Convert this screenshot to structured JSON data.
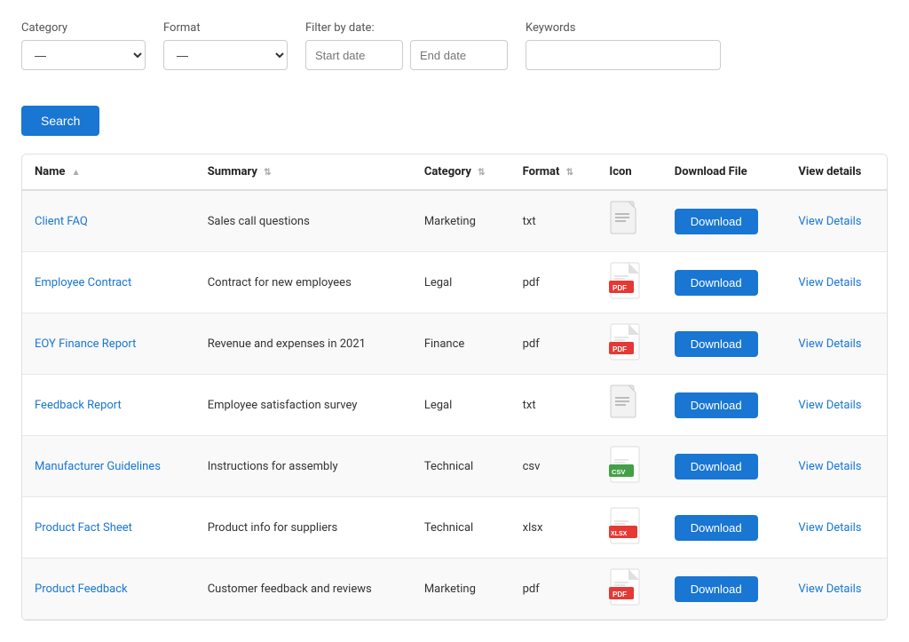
{
  "filters": {
    "category_label": "Category",
    "category_default": "—",
    "format_label": "Format",
    "format_default": "—",
    "date_label": "Filter by date:",
    "start_placeholder": "Start date",
    "end_placeholder": "End date",
    "keywords_label": "Keywords",
    "keywords_placeholder": "",
    "search_button": "Search"
  },
  "table": {
    "columns": [
      {
        "key": "name",
        "label": "Name",
        "sortable": true
      },
      {
        "key": "summary",
        "label": "Summary",
        "sortable": true
      },
      {
        "key": "category",
        "label": "Category",
        "sortable": true
      },
      {
        "key": "format",
        "label": "Format",
        "sortable": true
      },
      {
        "key": "icon",
        "label": "Icon",
        "sortable": false
      },
      {
        "key": "download",
        "label": "Download File",
        "sortable": false
      },
      {
        "key": "details",
        "label": "View details",
        "sortable": false
      }
    ],
    "download_label": "Download",
    "view_details_label": "View Details",
    "rows": [
      {
        "name": "Client FAQ",
        "summary": "Sales call questions",
        "category": "Marketing",
        "format": "txt",
        "icon_type": "txt"
      },
      {
        "name": "Employee Contract",
        "summary": "Contract for new employees",
        "category": "Legal",
        "format": "pdf",
        "icon_type": "pdf"
      },
      {
        "name": "EOY Finance Report",
        "summary": "Revenue and expenses in 2021",
        "category": "Finance",
        "format": "pdf",
        "icon_type": "pdf"
      },
      {
        "name": "Feedback Report",
        "summary": "Employee satisfaction survey",
        "category": "Legal",
        "format": "txt",
        "icon_type": "txt"
      },
      {
        "name": "Manufacturer Guidelines",
        "summary": "Instructions for assembly",
        "category": "Technical",
        "format": "csv",
        "icon_type": "csv"
      },
      {
        "name": "Product Fact Sheet",
        "summary": "Product info for suppliers",
        "category": "Technical",
        "format": "xlsx",
        "icon_type": "xlsx"
      },
      {
        "name": "Product Feedback",
        "summary": "Customer feedback and reviews",
        "category": "Marketing",
        "format": "pdf",
        "icon_type": "pdf"
      }
    ]
  }
}
